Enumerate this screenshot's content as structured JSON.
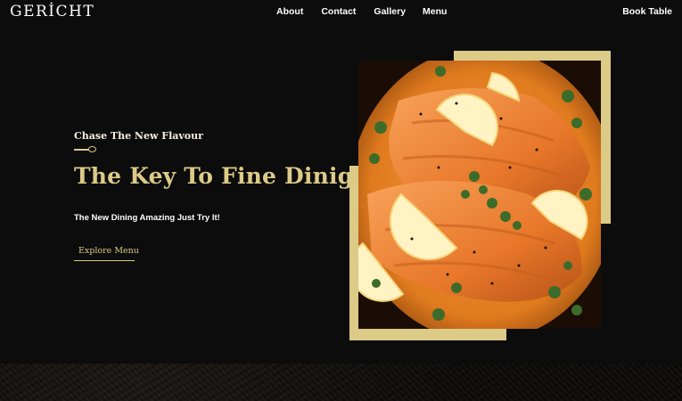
{
  "brand": {
    "logo_text": "GERİCHT"
  },
  "nav": {
    "items": [
      "About",
      "Contact",
      "Gallery",
      "Menu"
    ],
    "book_table": "Book Table"
  },
  "hero": {
    "subtitle": "Chase The New Flavour",
    "title": "The Key To Fine Dinig",
    "tagline": "The New Dining Amazing Just Try It!",
    "cta": "Explore Menu"
  },
  "colors": {
    "background": "#0c0c0c",
    "accent_gold": "#dcca87",
    "text_white": "#ffffff"
  },
  "icons": [
    "spoon-icon"
  ],
  "image": {
    "subject": "salmon-dish-photo"
  }
}
